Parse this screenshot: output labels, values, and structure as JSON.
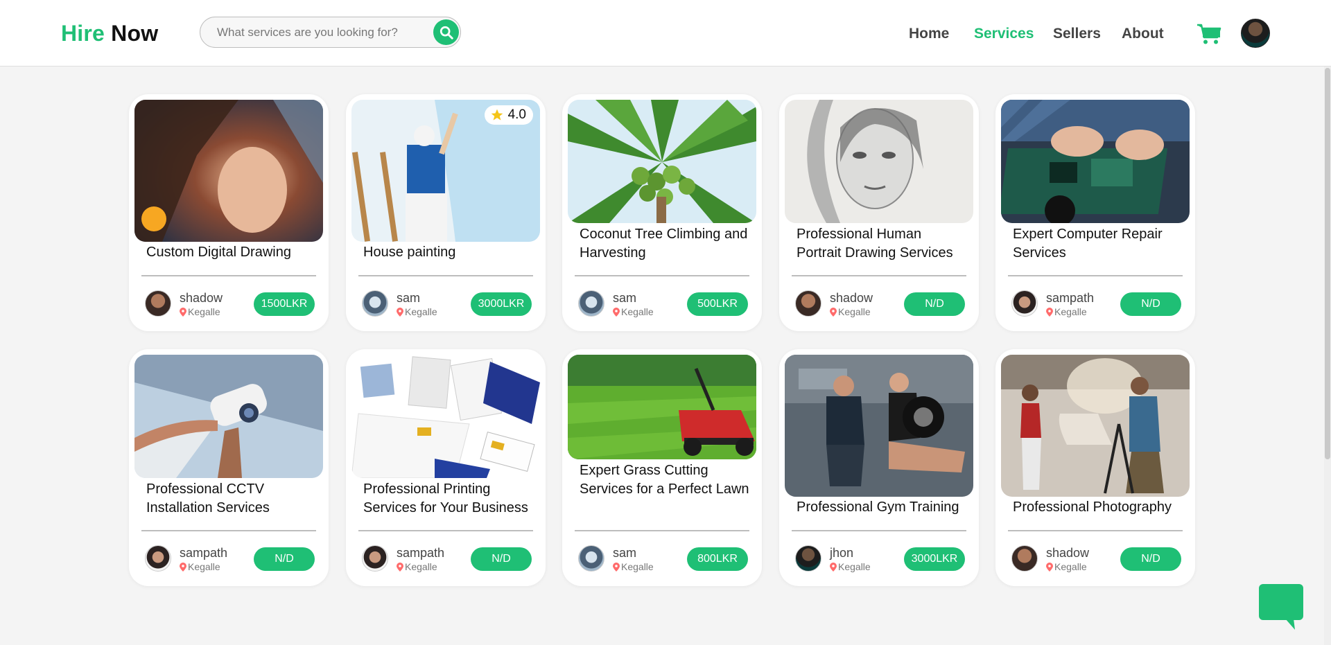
{
  "header": {
    "logo_part1": "Hire",
    "logo_part2": "Now",
    "search_placeholder": "What services are you looking for?",
    "nav": [
      "Home",
      "Services",
      "Sellers",
      "About"
    ],
    "active_nav": "Services"
  },
  "colors": {
    "accent": "#1fbf75",
    "location_pin": "#ff6b6b",
    "star": "#f5c518"
  },
  "cards": [
    {
      "title": "Custom Digital Drawing",
      "seller": "shadow",
      "location": "Kegalle",
      "price": "1500LKR",
      "image": "digital-portrait-art"
    },
    {
      "title": "House painting",
      "seller": "sam",
      "location": "Kegalle",
      "price": "3000LKR",
      "rating": "4.0",
      "image": "house-painter"
    },
    {
      "title": "Coconut Tree Climbing and Harvesting",
      "seller": "sam",
      "location": "Kegalle",
      "price": "500LKR",
      "image": "coconut-tree"
    },
    {
      "title": "Professional Human Portrait Drawing Services",
      "seller": "shadow",
      "location": "Kegalle",
      "price": "N/D",
      "image": "pencil-portrait"
    },
    {
      "title": "Expert Computer Repair Services",
      "seller": "sampath",
      "location": "Kegalle",
      "price": "N/D",
      "image": "circuit-board-repair"
    },
    {
      "title": "Professional CCTV Installation Services",
      "seller": "sampath",
      "location": "Kegalle",
      "price": "N/D",
      "image": "cctv-camera"
    },
    {
      "title": "Professional Printing Services for Your Business",
      "seller": "sampath",
      "location": "Kegalle",
      "price": "N/D",
      "image": "printed-materials"
    },
    {
      "title": "Expert Grass Cutting Services for a Perfect Lawn",
      "seller": "sam",
      "location": "Kegalle",
      "price": "800LKR",
      "image": "lawn-mower"
    },
    {
      "title": "Professional Gym Training",
      "seller": "jhon",
      "location": "Kegalle",
      "price": "3000LKR",
      "image": "gym-training"
    },
    {
      "title": "Professional Photography",
      "seller": "shadow",
      "location": "Kegalle",
      "price": "N/D",
      "image": "photo-studio"
    }
  ]
}
